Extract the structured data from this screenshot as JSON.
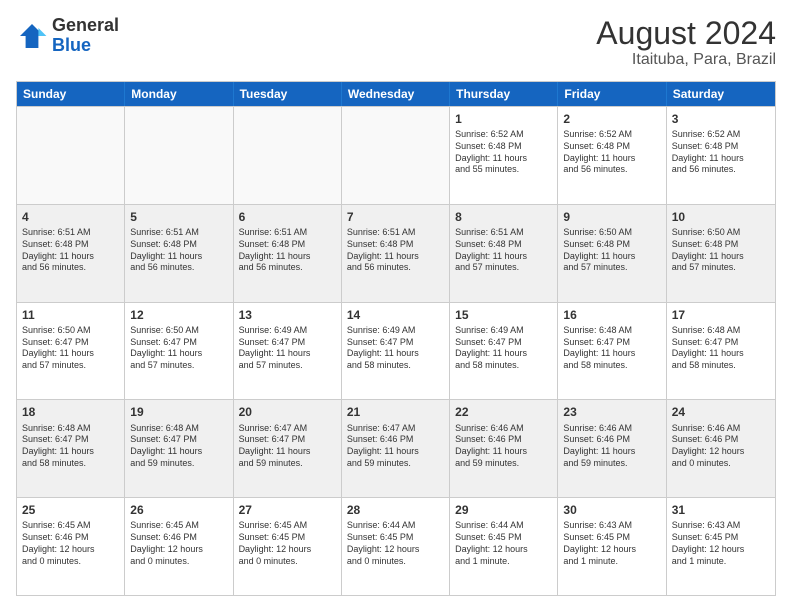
{
  "logo": {
    "line1": "General",
    "line2": "Blue"
  },
  "title": "August 2024",
  "subtitle": "Itaituba, Para, Brazil",
  "header_days": [
    "Sunday",
    "Monday",
    "Tuesday",
    "Wednesday",
    "Thursday",
    "Friday",
    "Saturday"
  ],
  "rows": [
    [
      {
        "day": "",
        "text": "",
        "empty": true
      },
      {
        "day": "",
        "text": "",
        "empty": true
      },
      {
        "day": "",
        "text": "",
        "empty": true
      },
      {
        "day": "",
        "text": "",
        "empty": true
      },
      {
        "day": "1",
        "text": "Sunrise: 6:52 AM\nSunset: 6:48 PM\nDaylight: 11 hours\nand 55 minutes.",
        "empty": false
      },
      {
        "day": "2",
        "text": "Sunrise: 6:52 AM\nSunset: 6:48 PM\nDaylight: 11 hours\nand 56 minutes.",
        "empty": false
      },
      {
        "day": "3",
        "text": "Sunrise: 6:52 AM\nSunset: 6:48 PM\nDaylight: 11 hours\nand 56 minutes.",
        "empty": false
      }
    ],
    [
      {
        "day": "4",
        "text": "Sunrise: 6:51 AM\nSunset: 6:48 PM\nDaylight: 11 hours\nand 56 minutes.",
        "empty": false
      },
      {
        "day": "5",
        "text": "Sunrise: 6:51 AM\nSunset: 6:48 PM\nDaylight: 11 hours\nand 56 minutes.",
        "empty": false
      },
      {
        "day": "6",
        "text": "Sunrise: 6:51 AM\nSunset: 6:48 PM\nDaylight: 11 hours\nand 56 minutes.",
        "empty": false
      },
      {
        "day": "7",
        "text": "Sunrise: 6:51 AM\nSunset: 6:48 PM\nDaylight: 11 hours\nand 56 minutes.",
        "empty": false
      },
      {
        "day": "8",
        "text": "Sunrise: 6:51 AM\nSunset: 6:48 PM\nDaylight: 11 hours\nand 57 minutes.",
        "empty": false
      },
      {
        "day": "9",
        "text": "Sunrise: 6:50 AM\nSunset: 6:48 PM\nDaylight: 11 hours\nand 57 minutes.",
        "empty": false
      },
      {
        "day": "10",
        "text": "Sunrise: 6:50 AM\nSunset: 6:48 PM\nDaylight: 11 hours\nand 57 minutes.",
        "empty": false
      }
    ],
    [
      {
        "day": "11",
        "text": "Sunrise: 6:50 AM\nSunset: 6:47 PM\nDaylight: 11 hours\nand 57 minutes.",
        "empty": false
      },
      {
        "day": "12",
        "text": "Sunrise: 6:50 AM\nSunset: 6:47 PM\nDaylight: 11 hours\nand 57 minutes.",
        "empty": false
      },
      {
        "day": "13",
        "text": "Sunrise: 6:49 AM\nSunset: 6:47 PM\nDaylight: 11 hours\nand 57 minutes.",
        "empty": false
      },
      {
        "day": "14",
        "text": "Sunrise: 6:49 AM\nSunset: 6:47 PM\nDaylight: 11 hours\nand 58 minutes.",
        "empty": false
      },
      {
        "day": "15",
        "text": "Sunrise: 6:49 AM\nSunset: 6:47 PM\nDaylight: 11 hours\nand 58 minutes.",
        "empty": false
      },
      {
        "day": "16",
        "text": "Sunrise: 6:48 AM\nSunset: 6:47 PM\nDaylight: 11 hours\nand 58 minutes.",
        "empty": false
      },
      {
        "day": "17",
        "text": "Sunrise: 6:48 AM\nSunset: 6:47 PM\nDaylight: 11 hours\nand 58 minutes.",
        "empty": false
      }
    ],
    [
      {
        "day": "18",
        "text": "Sunrise: 6:48 AM\nSunset: 6:47 PM\nDaylight: 11 hours\nand 58 minutes.",
        "empty": false
      },
      {
        "day": "19",
        "text": "Sunrise: 6:48 AM\nSunset: 6:47 PM\nDaylight: 11 hours\nand 59 minutes.",
        "empty": false
      },
      {
        "day": "20",
        "text": "Sunrise: 6:47 AM\nSunset: 6:47 PM\nDaylight: 11 hours\nand 59 minutes.",
        "empty": false
      },
      {
        "day": "21",
        "text": "Sunrise: 6:47 AM\nSunset: 6:46 PM\nDaylight: 11 hours\nand 59 minutes.",
        "empty": false
      },
      {
        "day": "22",
        "text": "Sunrise: 6:46 AM\nSunset: 6:46 PM\nDaylight: 11 hours\nand 59 minutes.",
        "empty": false
      },
      {
        "day": "23",
        "text": "Sunrise: 6:46 AM\nSunset: 6:46 PM\nDaylight: 11 hours\nand 59 minutes.",
        "empty": false
      },
      {
        "day": "24",
        "text": "Sunrise: 6:46 AM\nSunset: 6:46 PM\nDaylight: 12 hours\nand 0 minutes.",
        "empty": false
      }
    ],
    [
      {
        "day": "25",
        "text": "Sunrise: 6:45 AM\nSunset: 6:46 PM\nDaylight: 12 hours\nand 0 minutes.",
        "empty": false
      },
      {
        "day": "26",
        "text": "Sunrise: 6:45 AM\nSunset: 6:46 PM\nDaylight: 12 hours\nand 0 minutes.",
        "empty": false
      },
      {
        "day": "27",
        "text": "Sunrise: 6:45 AM\nSunset: 6:45 PM\nDaylight: 12 hours\nand 0 minutes.",
        "empty": false
      },
      {
        "day": "28",
        "text": "Sunrise: 6:44 AM\nSunset: 6:45 PM\nDaylight: 12 hours\nand 0 minutes.",
        "empty": false
      },
      {
        "day": "29",
        "text": "Sunrise: 6:44 AM\nSunset: 6:45 PM\nDaylight: 12 hours\nand 1 minute.",
        "empty": false
      },
      {
        "day": "30",
        "text": "Sunrise: 6:43 AM\nSunset: 6:45 PM\nDaylight: 12 hours\nand 1 minute.",
        "empty": false
      },
      {
        "day": "31",
        "text": "Sunrise: 6:43 AM\nSunset: 6:45 PM\nDaylight: 12 hours\nand 1 minute.",
        "empty": false
      }
    ]
  ]
}
